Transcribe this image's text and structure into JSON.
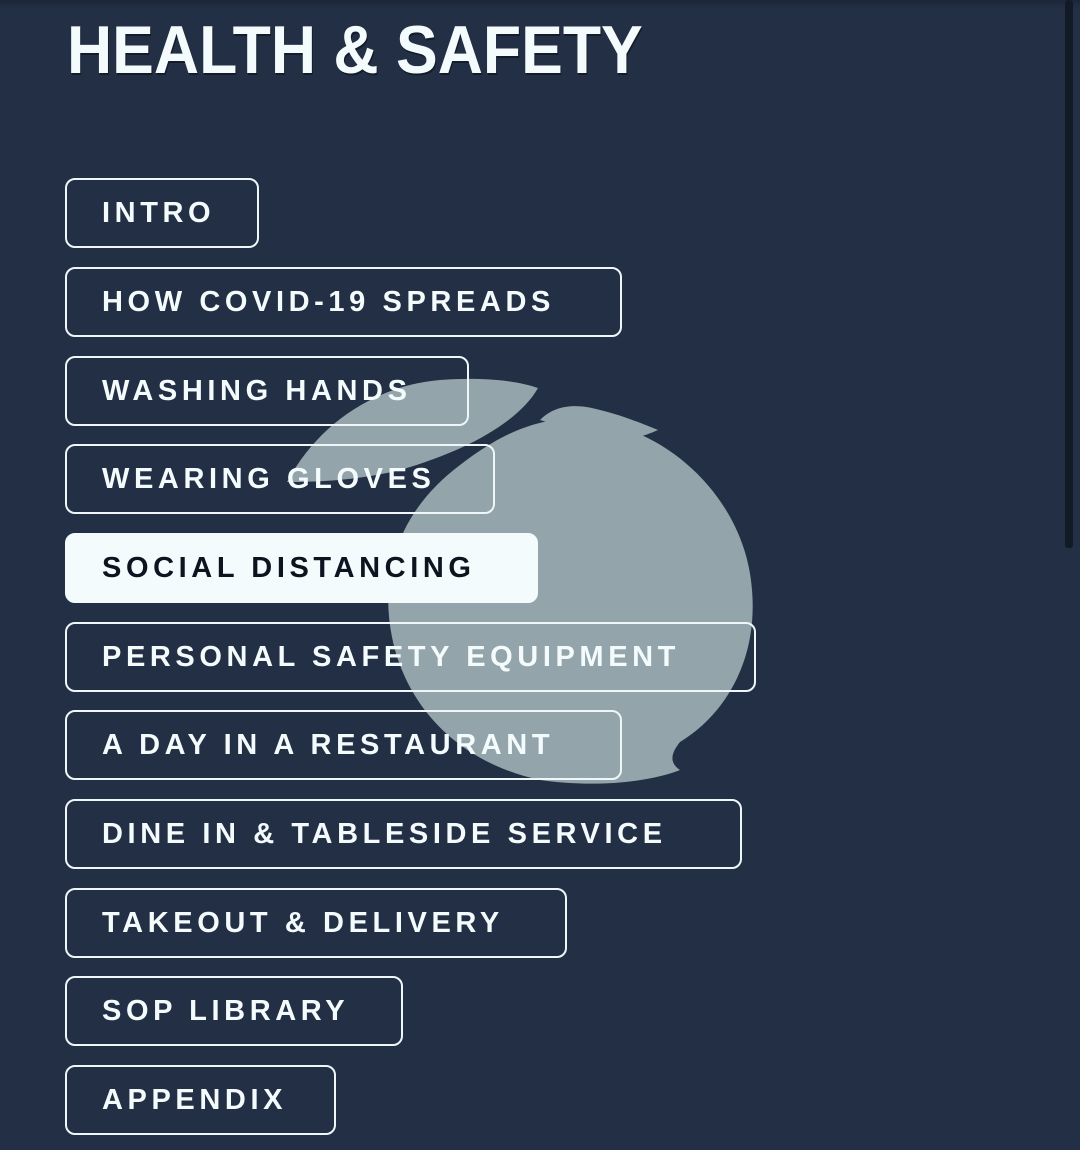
{
  "header": {
    "title": "HEALTH & SAFETY"
  },
  "nav": {
    "active_index": 4,
    "items": [
      {
        "label": "INTRO"
      },
      {
        "label": "HOW COVID-19 SPREADS"
      },
      {
        "label": "WASHING HANDS"
      },
      {
        "label": "WEARING GLOVES"
      },
      {
        "label": "SOCIAL DISTANCING"
      },
      {
        "label": "PERSONAL SAFETY EQUIPMENT"
      },
      {
        "label": "A DAY IN A RESTAURANT"
      },
      {
        "label": "DINE IN & TABLESIDE SERVICE"
      },
      {
        "label": "TAKEOUT & DELIVERY"
      },
      {
        "label": "SOP LIBRARY"
      },
      {
        "label": "APPENDIX"
      }
    ]
  },
  "background_logo": {
    "icon": "peach-logo-icon",
    "color": "#93a4aa"
  },
  "colors": {
    "background": "#232f44",
    "text": "#f4fbfd",
    "active_text": "#0d1420"
  }
}
